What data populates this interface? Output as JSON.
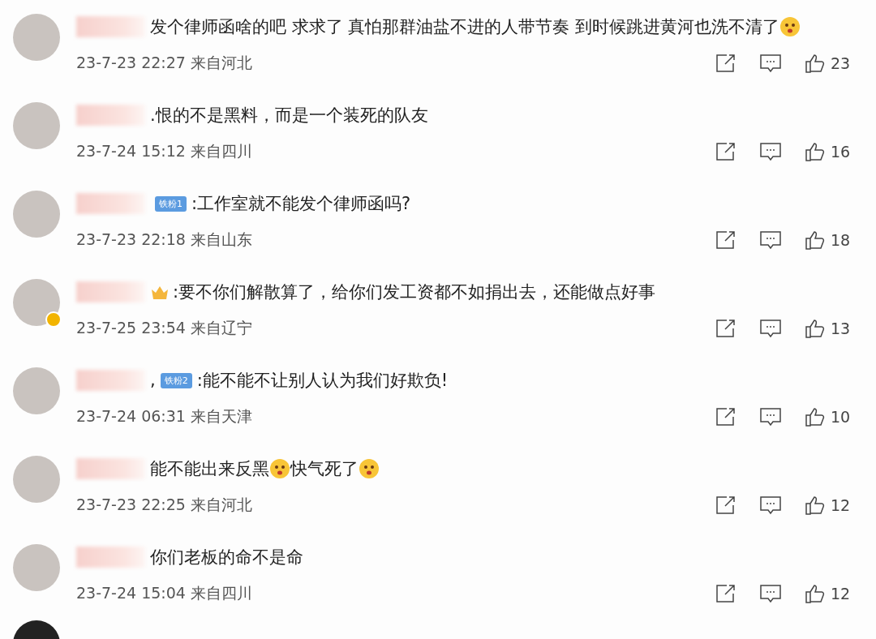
{
  "comments": [
    {
      "verified": false,
      "content": [
        {
          "kind": "text",
          "text": "发个律师函啥的吧 求求了 真怕那群油盐不进的人带节奏 到时候跳进黄河也洗不清了"
        },
        {
          "kind": "emoji"
        }
      ],
      "time": "23-7-23 22:27 来自河北",
      "likes": "23"
    },
    {
      "verified": false,
      "content": [
        {
          "kind": "text",
          "text": ".恨的不是黑料，而是一个装死的队友"
        }
      ],
      "time": "23-7-24 15:12 来自四川",
      "likes": "16"
    },
    {
      "verified": false,
      "content": [
        {
          "kind": "badge",
          "text": "铁粉1"
        },
        {
          "kind": "text",
          "text": ":工作室就不能发个律师函吗?"
        }
      ],
      "time": "23-7-23 22:18 来自山东",
      "likes": "18"
    },
    {
      "verified": true,
      "content": [
        {
          "kind": "vip"
        },
        {
          "kind": "text",
          "text": ":要不你们解散算了，给你们发工资都不如捐出去，还能做点好事"
        }
      ],
      "time": "23-7-25 23:54 来自辽宁",
      "likes": "13"
    },
    {
      "verified": false,
      "content": [
        {
          "kind": "text",
          "text": ","
        },
        {
          "kind": "badge",
          "text": "铁粉2"
        },
        {
          "kind": "text",
          "text": ":能不能不让别人认为我们好欺负!"
        }
      ],
      "time": "23-7-24 06:31 来自天津",
      "likes": "10"
    },
    {
      "verified": false,
      "content": [
        {
          "kind": "text",
          "text": "能不能出来反黑"
        },
        {
          "kind": "emoji"
        },
        {
          "kind": "text",
          "text": "快气死了"
        },
        {
          "kind": "emoji"
        }
      ],
      "time": "23-7-23 22:25 来自河北",
      "likes": "12"
    },
    {
      "verified": false,
      "content": [
        {
          "kind": "text",
          "text": "你们老板的命不是命"
        }
      ],
      "time": "23-7-24 15:04 来自四川",
      "likes": "12"
    }
  ]
}
